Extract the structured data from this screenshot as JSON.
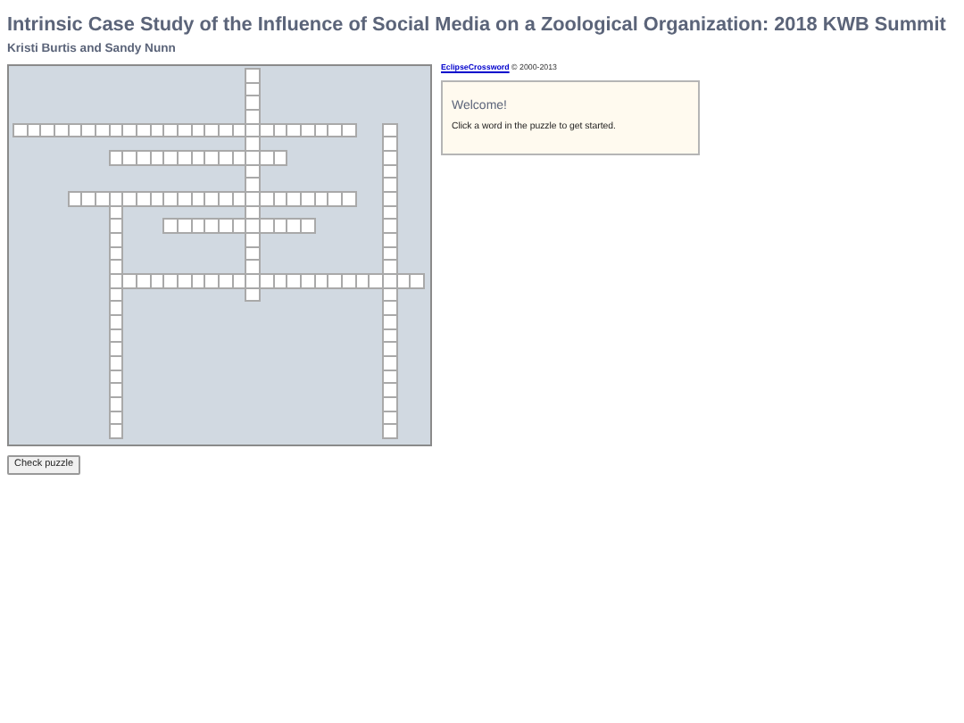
{
  "title": "Intrinsic Case Study of the Influence of Social Media on a Zoological Organization: 2018 KWB Summit",
  "authors": "Kristi Burtis and Sandy Nunn",
  "grid": [
    [
      false,
      false,
      false,
      false,
      false,
      false,
      false,
      false,
      false,
      false,
      false,
      false,
      false,
      false,
      false,
      false,
      false,
      true,
      false,
      false,
      false,
      false,
      false,
      false,
      false,
      false,
      false,
      false,
      false,
      false
    ],
    [
      false,
      false,
      false,
      false,
      false,
      false,
      false,
      false,
      false,
      false,
      false,
      false,
      false,
      false,
      false,
      false,
      false,
      true,
      false,
      false,
      false,
      false,
      false,
      false,
      false,
      false,
      false,
      false,
      false,
      false
    ],
    [
      false,
      false,
      false,
      false,
      false,
      false,
      false,
      false,
      false,
      false,
      false,
      false,
      false,
      false,
      false,
      false,
      false,
      true,
      false,
      false,
      false,
      false,
      false,
      false,
      false,
      false,
      false,
      false,
      false,
      false
    ],
    [
      false,
      false,
      false,
      false,
      false,
      false,
      false,
      false,
      false,
      false,
      false,
      false,
      false,
      false,
      false,
      false,
      false,
      true,
      false,
      false,
      false,
      false,
      false,
      false,
      false,
      false,
      false,
      false,
      false,
      false
    ],
    [
      true,
      true,
      true,
      true,
      true,
      true,
      true,
      true,
      true,
      true,
      true,
      true,
      true,
      true,
      true,
      true,
      true,
      true,
      true,
      true,
      true,
      true,
      true,
      true,
      true,
      false,
      false,
      true,
      false,
      false
    ],
    [
      false,
      false,
      false,
      false,
      false,
      false,
      false,
      false,
      false,
      false,
      false,
      false,
      false,
      false,
      false,
      false,
      false,
      true,
      false,
      false,
      false,
      false,
      false,
      false,
      false,
      false,
      false,
      true,
      false,
      false
    ],
    [
      false,
      false,
      false,
      false,
      false,
      false,
      false,
      true,
      true,
      true,
      true,
      true,
      true,
      true,
      true,
      true,
      true,
      true,
      true,
      true,
      false,
      false,
      false,
      false,
      false,
      false,
      false,
      true,
      false,
      false
    ],
    [
      false,
      false,
      false,
      false,
      false,
      false,
      false,
      false,
      false,
      false,
      false,
      false,
      false,
      false,
      false,
      false,
      false,
      true,
      false,
      false,
      false,
      false,
      false,
      false,
      false,
      false,
      false,
      true,
      false,
      false
    ],
    [
      false,
      false,
      false,
      false,
      false,
      false,
      false,
      false,
      false,
      false,
      false,
      false,
      false,
      false,
      false,
      false,
      false,
      true,
      false,
      false,
      false,
      false,
      false,
      false,
      false,
      false,
      false,
      true,
      false,
      false
    ],
    [
      false,
      false,
      false,
      false,
      true,
      true,
      true,
      true,
      true,
      true,
      true,
      true,
      true,
      true,
      true,
      true,
      true,
      true,
      true,
      true,
      true,
      true,
      true,
      true,
      true,
      false,
      false,
      true,
      false,
      false
    ],
    [
      false,
      false,
      false,
      false,
      false,
      false,
      false,
      true,
      false,
      false,
      false,
      false,
      false,
      false,
      false,
      false,
      false,
      true,
      false,
      false,
      false,
      false,
      false,
      false,
      false,
      false,
      false,
      true,
      false,
      false
    ],
    [
      false,
      false,
      false,
      false,
      false,
      false,
      false,
      true,
      false,
      false,
      false,
      true,
      true,
      true,
      true,
      true,
      true,
      true,
      true,
      true,
      true,
      true,
      false,
      false,
      false,
      false,
      false,
      true,
      false,
      false
    ],
    [
      false,
      false,
      false,
      false,
      false,
      false,
      false,
      true,
      false,
      false,
      false,
      false,
      false,
      false,
      false,
      false,
      false,
      true,
      false,
      false,
      false,
      false,
      false,
      false,
      false,
      false,
      false,
      true,
      false,
      false
    ],
    [
      false,
      false,
      false,
      false,
      false,
      false,
      false,
      true,
      false,
      false,
      false,
      false,
      false,
      false,
      false,
      false,
      false,
      true,
      false,
      false,
      false,
      false,
      false,
      false,
      false,
      false,
      false,
      true,
      false,
      false
    ],
    [
      false,
      false,
      false,
      false,
      false,
      false,
      false,
      true,
      false,
      false,
      false,
      false,
      false,
      false,
      false,
      false,
      false,
      true,
      false,
      false,
      false,
      false,
      false,
      false,
      false,
      false,
      false,
      true,
      false,
      false
    ],
    [
      false,
      false,
      false,
      false,
      false,
      false,
      false,
      true,
      true,
      true,
      true,
      true,
      true,
      true,
      true,
      true,
      true,
      true,
      true,
      true,
      true,
      true,
      true,
      true,
      true,
      true,
      true,
      true,
      true,
      true
    ],
    [
      false,
      false,
      false,
      false,
      false,
      false,
      false,
      true,
      false,
      false,
      false,
      false,
      false,
      false,
      false,
      false,
      false,
      true,
      false,
      false,
      false,
      false,
      false,
      false,
      false,
      false,
      false,
      true,
      false,
      false
    ],
    [
      false,
      false,
      false,
      false,
      false,
      false,
      false,
      true,
      false,
      false,
      false,
      false,
      false,
      false,
      false,
      false,
      false,
      false,
      false,
      false,
      false,
      false,
      false,
      false,
      false,
      false,
      false,
      true,
      false,
      false
    ],
    [
      false,
      false,
      false,
      false,
      false,
      false,
      false,
      true,
      false,
      false,
      false,
      false,
      false,
      false,
      false,
      false,
      false,
      false,
      false,
      false,
      false,
      false,
      false,
      false,
      false,
      false,
      false,
      true,
      false,
      false
    ],
    [
      false,
      false,
      false,
      false,
      false,
      false,
      false,
      true,
      false,
      false,
      false,
      false,
      false,
      false,
      false,
      false,
      false,
      false,
      false,
      false,
      false,
      false,
      false,
      false,
      false,
      false,
      false,
      true,
      false,
      false
    ],
    [
      false,
      false,
      false,
      false,
      false,
      false,
      false,
      true,
      false,
      false,
      false,
      false,
      false,
      false,
      false,
      false,
      false,
      false,
      false,
      false,
      false,
      false,
      false,
      false,
      false,
      false,
      false,
      true,
      false,
      false
    ],
    [
      false,
      false,
      false,
      false,
      false,
      false,
      false,
      true,
      false,
      false,
      false,
      false,
      false,
      false,
      false,
      false,
      false,
      false,
      false,
      false,
      false,
      false,
      false,
      false,
      false,
      false,
      false,
      true,
      false,
      false
    ],
    [
      false,
      false,
      false,
      false,
      false,
      false,
      false,
      true,
      false,
      false,
      false,
      false,
      false,
      false,
      false,
      false,
      false,
      false,
      false,
      false,
      false,
      false,
      false,
      false,
      false,
      false,
      false,
      true,
      false,
      false
    ],
    [
      false,
      false,
      false,
      false,
      false,
      false,
      false,
      true,
      false,
      false,
      false,
      false,
      false,
      false,
      false,
      false,
      false,
      false,
      false,
      false,
      false,
      false,
      false,
      false,
      false,
      false,
      false,
      true,
      false,
      false
    ],
    [
      false,
      false,
      false,
      false,
      false,
      false,
      false,
      true,
      false,
      false,
      false,
      false,
      false,
      false,
      false,
      false,
      false,
      false,
      false,
      false,
      false,
      false,
      false,
      false,
      false,
      false,
      false,
      true,
      false,
      false
    ],
    [
      false,
      false,
      false,
      false,
      false,
      false,
      false,
      true,
      false,
      false,
      false,
      false,
      false,
      false,
      false,
      false,
      false,
      false,
      false,
      false,
      false,
      false,
      false,
      false,
      false,
      false,
      false,
      true,
      false,
      false
    ],
    [
      false,
      false,
      false,
      false,
      false,
      false,
      false,
      true,
      false,
      false,
      false,
      false,
      false,
      false,
      false,
      false,
      false,
      false,
      false,
      false,
      false,
      false,
      false,
      false,
      false,
      false,
      false,
      true,
      false,
      false
    ]
  ],
  "credit": {
    "link": "EclipseCrossword",
    "text": "© 2000-2013"
  },
  "panel": {
    "heading": "Welcome!",
    "text": "Click a word in the puzzle to get started."
  },
  "button": "Check puzzle"
}
